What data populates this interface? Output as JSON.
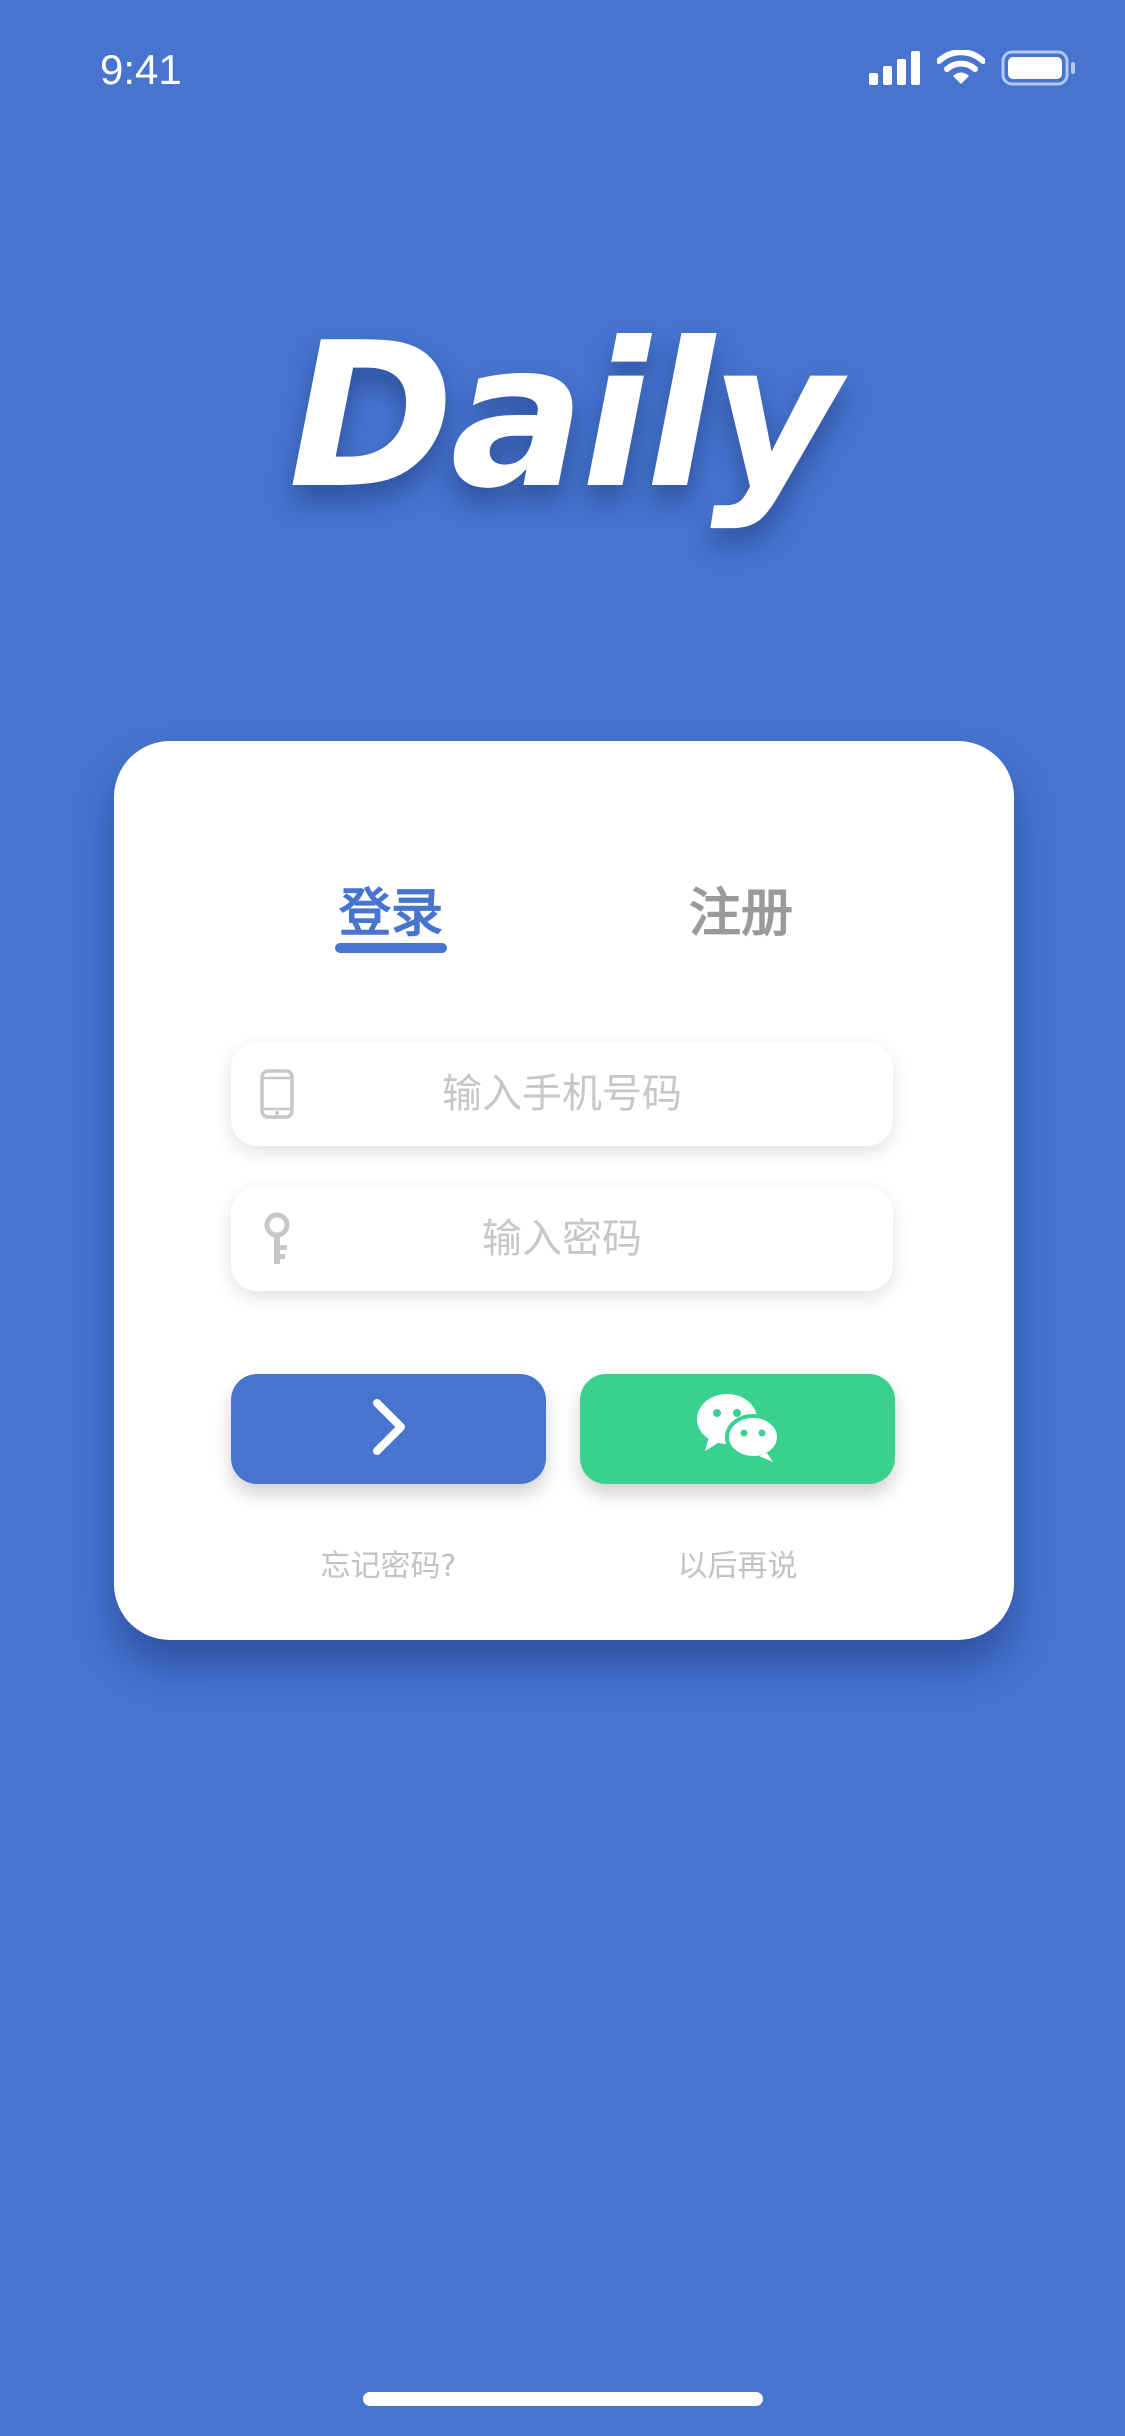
{
  "status_bar": {
    "time": "9:41",
    "icons": [
      "signal-icon",
      "wifi-icon",
      "battery-icon"
    ]
  },
  "app": {
    "logo_text": "Daily"
  },
  "auth_card": {
    "tabs": [
      {
        "label": "登录",
        "active": true
      },
      {
        "label": "注册",
        "active": false
      }
    ],
    "phone_field": {
      "icon": "phone-icon",
      "placeholder": "输入手机号码",
      "value": ""
    },
    "password_field": {
      "icon": "key-icon",
      "placeholder": "输入密码",
      "value": ""
    },
    "login_button": {
      "icon": "chevron-right-icon"
    },
    "wechat_button": {
      "icon": "wechat-icon"
    },
    "forgot_link": "忘记密码?",
    "later_link": "以后再说"
  },
  "colors": {
    "background": "#4674cf",
    "accent": "#4674cf",
    "wechat": "#3ad18f",
    "inactive_tab": "#9a9a9a",
    "placeholder": "#c7c7c7",
    "link": "#c2c2c2"
  }
}
